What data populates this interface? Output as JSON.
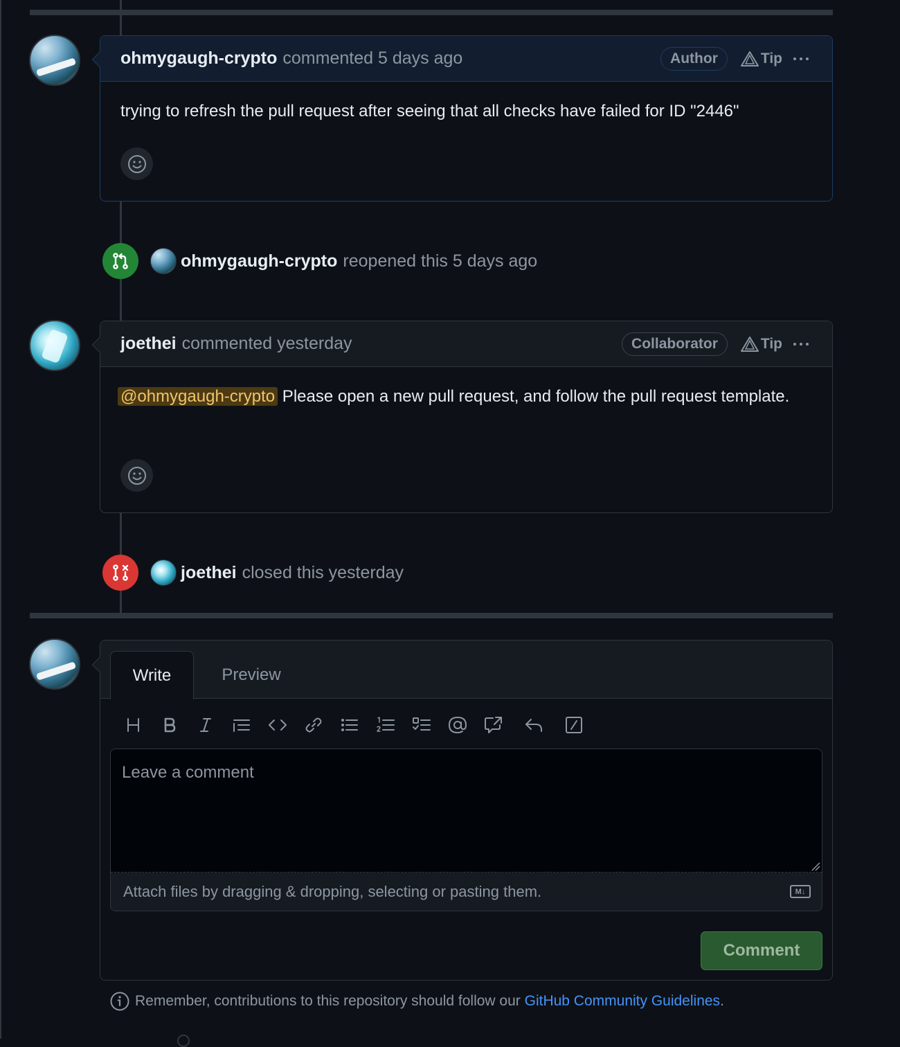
{
  "comments": [
    {
      "author": "ohmygaugh-crypto",
      "meta": "commented 5 days ago",
      "role_badge": "Author",
      "tip_label": "Tip",
      "body_text": "trying to refresh the pull request after seeing that all checks have failed for ID \"2446\""
    },
    {
      "author": "joethei",
      "meta": "commented yesterday",
      "role_badge": "Collaborator",
      "tip_label": "Tip",
      "mention": "@ohmygaugh-crypto",
      "body_text": " Please open a new pull request, and follow the pull request template."
    }
  ],
  "events": [
    {
      "actor": "ohmygaugh-crypto",
      "action": "reopened this 5 days ago",
      "icon": "git-pull-request-icon",
      "color": "#238636"
    },
    {
      "actor": "joethei",
      "action": "closed this yesterday",
      "icon": "git-pull-request-closed-icon",
      "color": "#da3633"
    }
  ],
  "editor": {
    "tabs": {
      "write": "Write",
      "preview": "Preview"
    },
    "toolbar_icons": [
      "heading-icon",
      "bold-icon",
      "italic-icon",
      "quote-icon",
      "code-icon",
      "link-icon",
      "unordered-list-icon",
      "ordered-list-icon",
      "task-list-icon",
      "mention-icon",
      "cross-reference-icon",
      "reply-icon",
      "slash-commands-icon"
    ],
    "placeholder": "Leave a comment",
    "attach_text": "Attach files by dragging & dropping, selecting or pasting them.",
    "markdown_badge": "M↓",
    "submit_label": "Comment"
  },
  "footer": {
    "prefix": "Remember, contributions to this repository should follow our ",
    "link_text": "GitHub Community Guidelines",
    "suffix": "."
  },
  "colors": {
    "background": "#0d1117",
    "link": "#4493f8",
    "mention_bg": "#4d3a12",
    "submit_bg": "#2a5a2f"
  }
}
